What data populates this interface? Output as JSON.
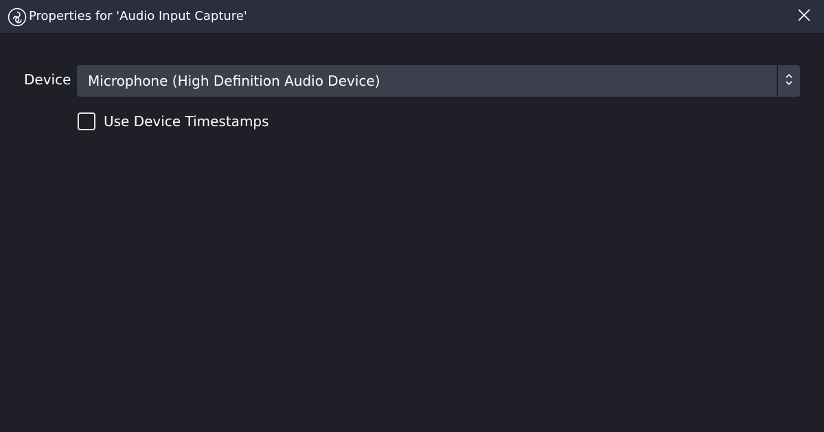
{
  "window": {
    "title": "Properties for 'Audio Input Capture'",
    "app_icon": "obs-logo-icon",
    "close_icon": "close-icon"
  },
  "form": {
    "device_label": "Device",
    "device_value": "Microphone (High Definition Audio Device)",
    "device_arrows_icon": "chevron-up-down-icon",
    "timestamps_label": "Use Device Timestamps",
    "timestamps_checked": false
  },
  "colors": {
    "background": "#1e1f27",
    "titlebar": "#2a2e3d",
    "select_background": "#3c404d",
    "text": "#ffffff"
  }
}
